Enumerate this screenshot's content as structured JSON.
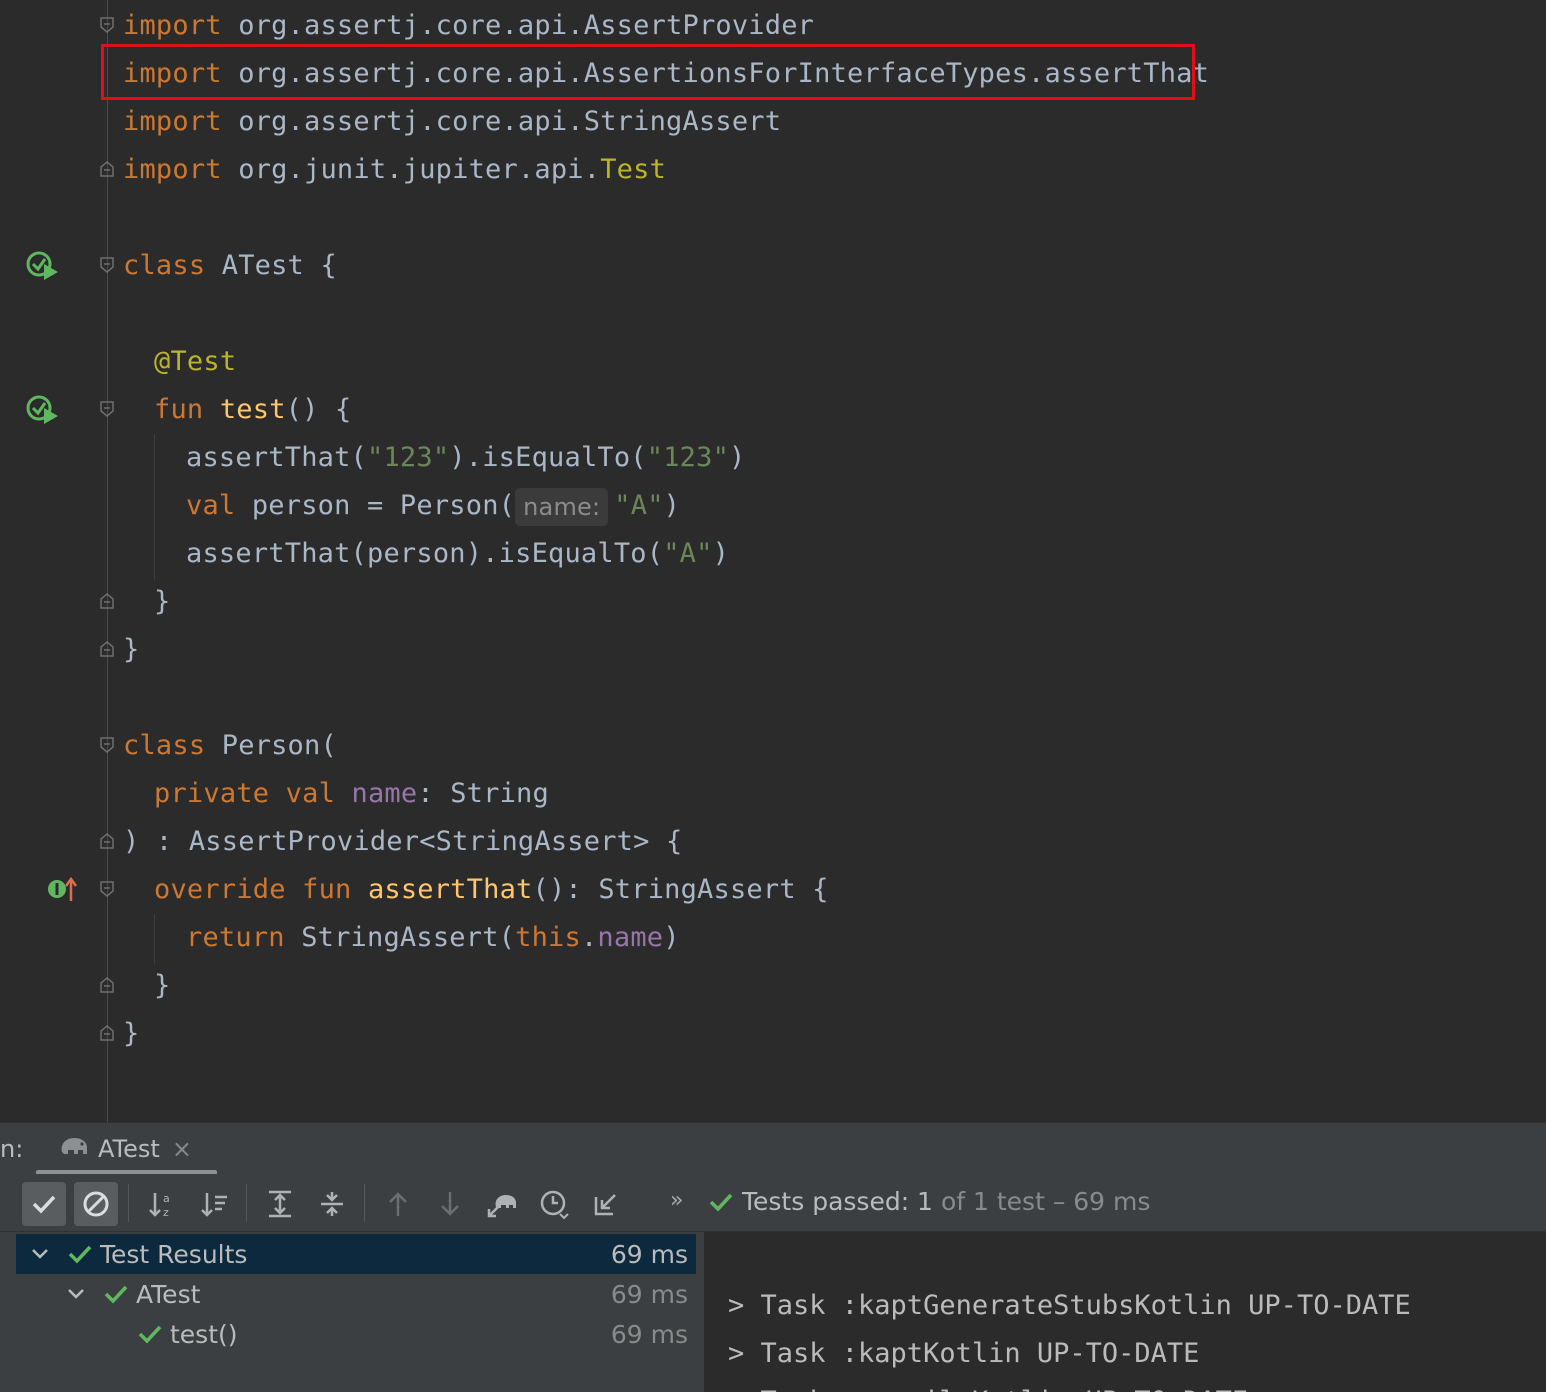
{
  "editor": {
    "highlight_color": "#e0101a",
    "lines": {
      "l1": {
        "kw": "import",
        "rest": " org.assertj.core.api.AssertProvider"
      },
      "l2": {
        "kw": "import",
        "rest": " org.assertj.core.api.AssertionsForInterfaceTypes.assertThat"
      },
      "l3": {
        "kw": "import",
        "rest": " org.assertj.core.api.StringAssert"
      },
      "l4": {
        "kw": "import",
        "rest": " org.junit.jupiter.api.",
        "cls": "Test"
      },
      "l6": {
        "kw": "class",
        "rest": " ATest {"
      },
      "l8": {
        "ann": "@Test"
      },
      "l9": {
        "kw": "fun",
        "fn": " test",
        "rest": "() {"
      },
      "l10": {
        "a": "assertThat(",
        "s1": "\"123\"",
        "b": ").isEqualTo(",
        "s2": "\"123\"",
        "c": ")"
      },
      "l11": {
        "kw": "val",
        "a": " person = Person(",
        "hint": "name:",
        "s": "\"A\"",
        "c": ")"
      },
      "l12": {
        "a": "assertThat(person).isEqualTo(",
        "s": "\"A\"",
        "c": ")"
      },
      "l13": {
        "a": "}"
      },
      "l14": {
        "a": "}"
      },
      "l16": {
        "kw": "class",
        "rest": " Person("
      },
      "l17": {
        "kw1": "private",
        "kw2": " val",
        "prop": " name",
        "rest": ": String"
      },
      "l18": {
        "rest": ") : AssertProvider<StringAssert> {"
      },
      "l19": {
        "kw1": "override",
        "kw2": " fun",
        "fn": " assertThat",
        "rest": "(): StringAssert {"
      },
      "l20": {
        "kw1": "return",
        "a": " StringAssert(",
        "kw2": "this",
        "dot": ".",
        "prop": "name",
        "c": ")"
      },
      "l21": {
        "a": "}"
      },
      "l22": {
        "a": "}"
      }
    },
    "gutter_icons": [
      "run-test-icon",
      "run-test-icon",
      "implements-icon"
    ]
  },
  "run_panel": {
    "label": "n:",
    "tab_name": "ATest",
    "tab_close": "×",
    "status_passed": "Tests passed: 1",
    "status_rest": "of 1 test – 69 ms",
    "more": "»",
    "tree": [
      {
        "label": "Test Results",
        "time": "69 ms"
      },
      {
        "label": "ATest",
        "time": "69 ms"
      },
      {
        "label": "test()",
        "time": "69 ms"
      }
    ],
    "console": [
      "> Task :kaptGenerateStubsKotlin UP-TO-DATE",
      "> Task :kaptKotlin UP-TO-DATE",
      "> Task :compileKotlin UP-TO-DATE"
    ],
    "colors": {
      "pass": "#5fb85f",
      "selected_row": "#0d293e"
    }
  }
}
